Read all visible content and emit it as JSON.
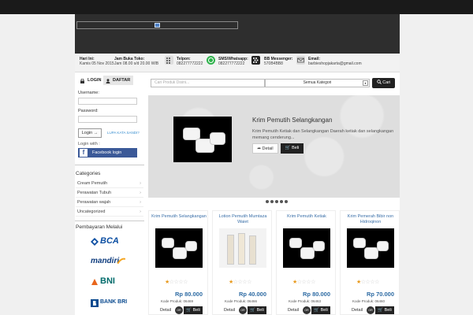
{
  "info": {
    "hari_label": "Hari Ini:",
    "hari_value": "Kamis 05 Nov 2015",
    "jam_label": "Jam Buka Toko:",
    "jam_value": "Jam 08.00 s/d 20.00 WIB",
    "telpon_label": "Telpon:",
    "telpon_value": "082277772222",
    "sms_label": "SMS/Whatsapp:",
    "sms_value": "082277772222",
    "bb_label": "BB Messenger:",
    "bb_value": "570B4BB8",
    "email_label": "Email:",
    "email_value": "barbieshopjakarta@gmail.com"
  },
  "login": {
    "tab_login": "LOGIN",
    "tab_daftar": "DAFTAR",
    "username_label": "Username:",
    "password_label": "Password:",
    "login_button": "Login →",
    "lupa": "LUPA KATA SANDI?",
    "login_with": "Login with :",
    "facebook": "Facebook login"
  },
  "categories": {
    "title": "Categories",
    "items": [
      "Cream Pemutih",
      "Perawatan Tubuh",
      "Perawatan wajah",
      "Uncategorized"
    ]
  },
  "payment": {
    "title": "Pembayaran Melalui",
    "banks": [
      "BCA",
      "mandiri",
      "BNI",
      "BANK BRI"
    ]
  },
  "search": {
    "placeholder": "Cari Produk Disini...",
    "category_select": "Semua Kategori",
    "button": "Cari"
  },
  "slider": {
    "title": "Krim Pemutih Selangkangan",
    "description": "Krim Pemutih Ketiak dan Selangkangan Daerah ketiak dan selangkangan memang cenderung...",
    "detail": "Detail",
    "beli": "Beli"
  },
  "products": [
    {
      "name": "Krim Pemutih Selangkangan",
      "price": "Rp 80.000",
      "kode": "Kode Produk: 06469",
      "rating": 1
    },
    {
      "name": "Lotion Pemutih Mumtaza Waiet",
      "price": "Rp 40.000",
      "kode": "Kode Produk: 06466",
      "rating": 1
    },
    {
      "name": "Krim Pemutih Ketiak",
      "price": "Rp 80.000",
      "kode": "Kode Produk: 06463",
      "rating": 1
    },
    {
      "name": "Krim Pemerah Bibir non Hidroqinon",
      "price": "Rp 70.000",
      "kode": "Kode Produk: 06460",
      "rating": 1
    }
  ],
  "card_buttons": {
    "detail": "Detail",
    "or": "OR",
    "beli": "Beli"
  },
  "colors": {
    "accent": "#3a6fa8",
    "dark": "#222222",
    "facebook": "#3b5998"
  },
  "icons": {
    "phone": "phone-icon",
    "whatsapp": "whatsapp-icon",
    "bbm": "blackberry-icon",
    "email": "email-icon",
    "lock": "lock-icon",
    "user": "user-icon",
    "search": "search-icon",
    "cart": "cart-icon",
    "share": "share-icon"
  }
}
